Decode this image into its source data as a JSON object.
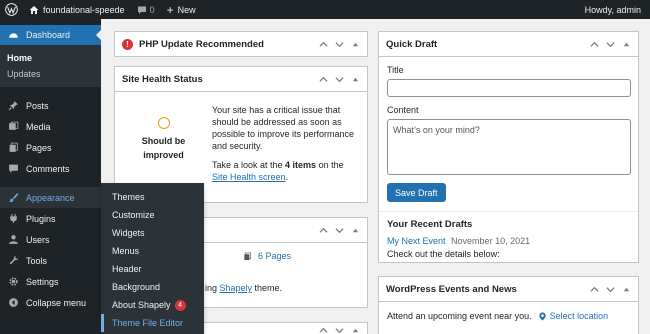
{
  "adminbar": {
    "site_name": "foundational-speede",
    "comment_count": "0",
    "new_label": "New",
    "howdy": "Howdy, admin"
  },
  "sidebar": {
    "dashboard": "Dashboard",
    "sub_home": "Home",
    "sub_updates": "Updates",
    "items": [
      {
        "label": "Posts",
        "icon": "pushpin-icon"
      },
      {
        "label": "Media",
        "icon": "media-icon"
      },
      {
        "label": "Pages",
        "icon": "pages-icon"
      },
      {
        "label": "Comments",
        "icon": "comment-icon"
      }
    ],
    "appearance": "Appearance",
    "items2": [
      {
        "label": "Plugins",
        "icon": "plugin-icon"
      },
      {
        "label": "Users",
        "icon": "users-icon"
      },
      {
        "label": "Tools",
        "icon": "tools-icon"
      },
      {
        "label": "Settings",
        "icon": "settings-icon"
      }
    ],
    "collapse": "Collapse menu"
  },
  "flyout": {
    "items": [
      "Themes",
      "Customize",
      "Widgets",
      "Menus",
      "Header",
      "Background",
      "About Shapely",
      "Theme File Editor"
    ],
    "badge": "4"
  },
  "php_panel": {
    "title": "PHP Update Recommended"
  },
  "health_panel": {
    "title": "Site Health Status",
    "status": "Should be improved",
    "message": "Your site has a critical issue that should be addressed as soon as possible to improve its performance and security.",
    "take_look_prefix": "Take a look at the ",
    "items_count": "4 items",
    "take_look_mid": " on the ",
    "link": "Site Health screen",
    "take_look_suffix": "."
  },
  "glance_panel": {
    "pages": "6 Pages",
    "theme_prefix": "ing ",
    "theme_link": "Shapely",
    "theme_suffix": " theme."
  },
  "quick_draft": {
    "title": "Quick Draft",
    "title_label": "Title",
    "content_label": "Content",
    "content_placeholder": "What’s on your mind?",
    "save_label": "Save Draft",
    "recent_title": "Your Recent Drafts",
    "draft_title": "My Next Event",
    "draft_date": "November 10, 2021",
    "draft_excerpt": "Check out the details below:"
  },
  "events_panel": {
    "title": "WordPress Events and News",
    "text": "Attend an upcoming event near you.",
    "select_location": "Select location"
  },
  "colors": {
    "accent": "#2271b1",
    "sidebar_bg": "#1d2327",
    "alert": "#d63638",
    "health_ring": "#dba617"
  }
}
